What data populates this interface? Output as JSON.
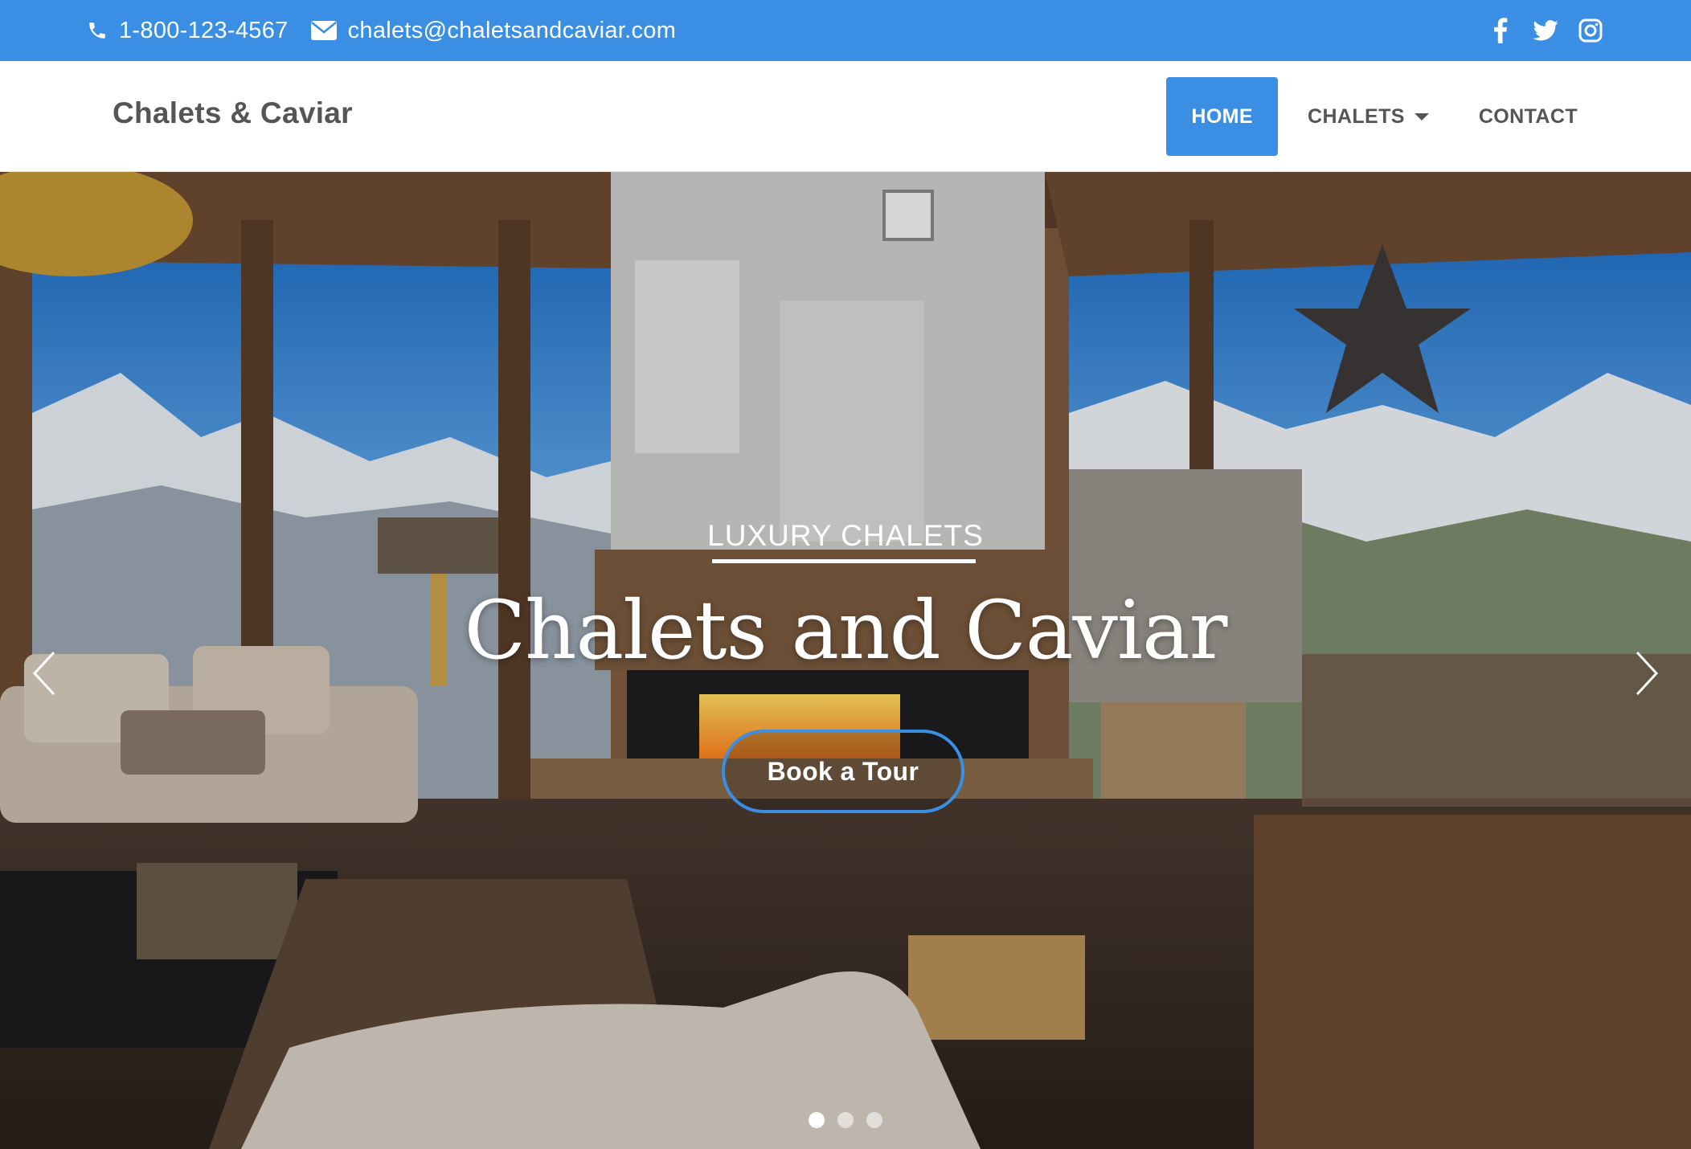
{
  "topbar": {
    "phone": "1-800-123-4567",
    "email": "chalets@chaletsandcaviar.com",
    "phone_icon": "phone-icon",
    "email_icon": "envelope-icon",
    "social": [
      "facebook-icon",
      "twitter-icon",
      "instagram-icon"
    ],
    "background_color": "#3a8fe4"
  },
  "navbar": {
    "brand": "Chalets & Caviar",
    "items": [
      {
        "label": "HOME",
        "active": true
      },
      {
        "label": "CHALETS",
        "dropdown": true
      },
      {
        "label": "CONTACT"
      }
    ],
    "active_color": "#3a8fe4"
  },
  "hero": {
    "kicker": "LUXURY CHALETS",
    "headline": "Chalets and Caviar",
    "cta_label": "Book a Tour",
    "prev_icon": "chevron-left-icon",
    "next_icon": "chevron-right-icon",
    "slides_count": 3,
    "active_slide": 1
  }
}
